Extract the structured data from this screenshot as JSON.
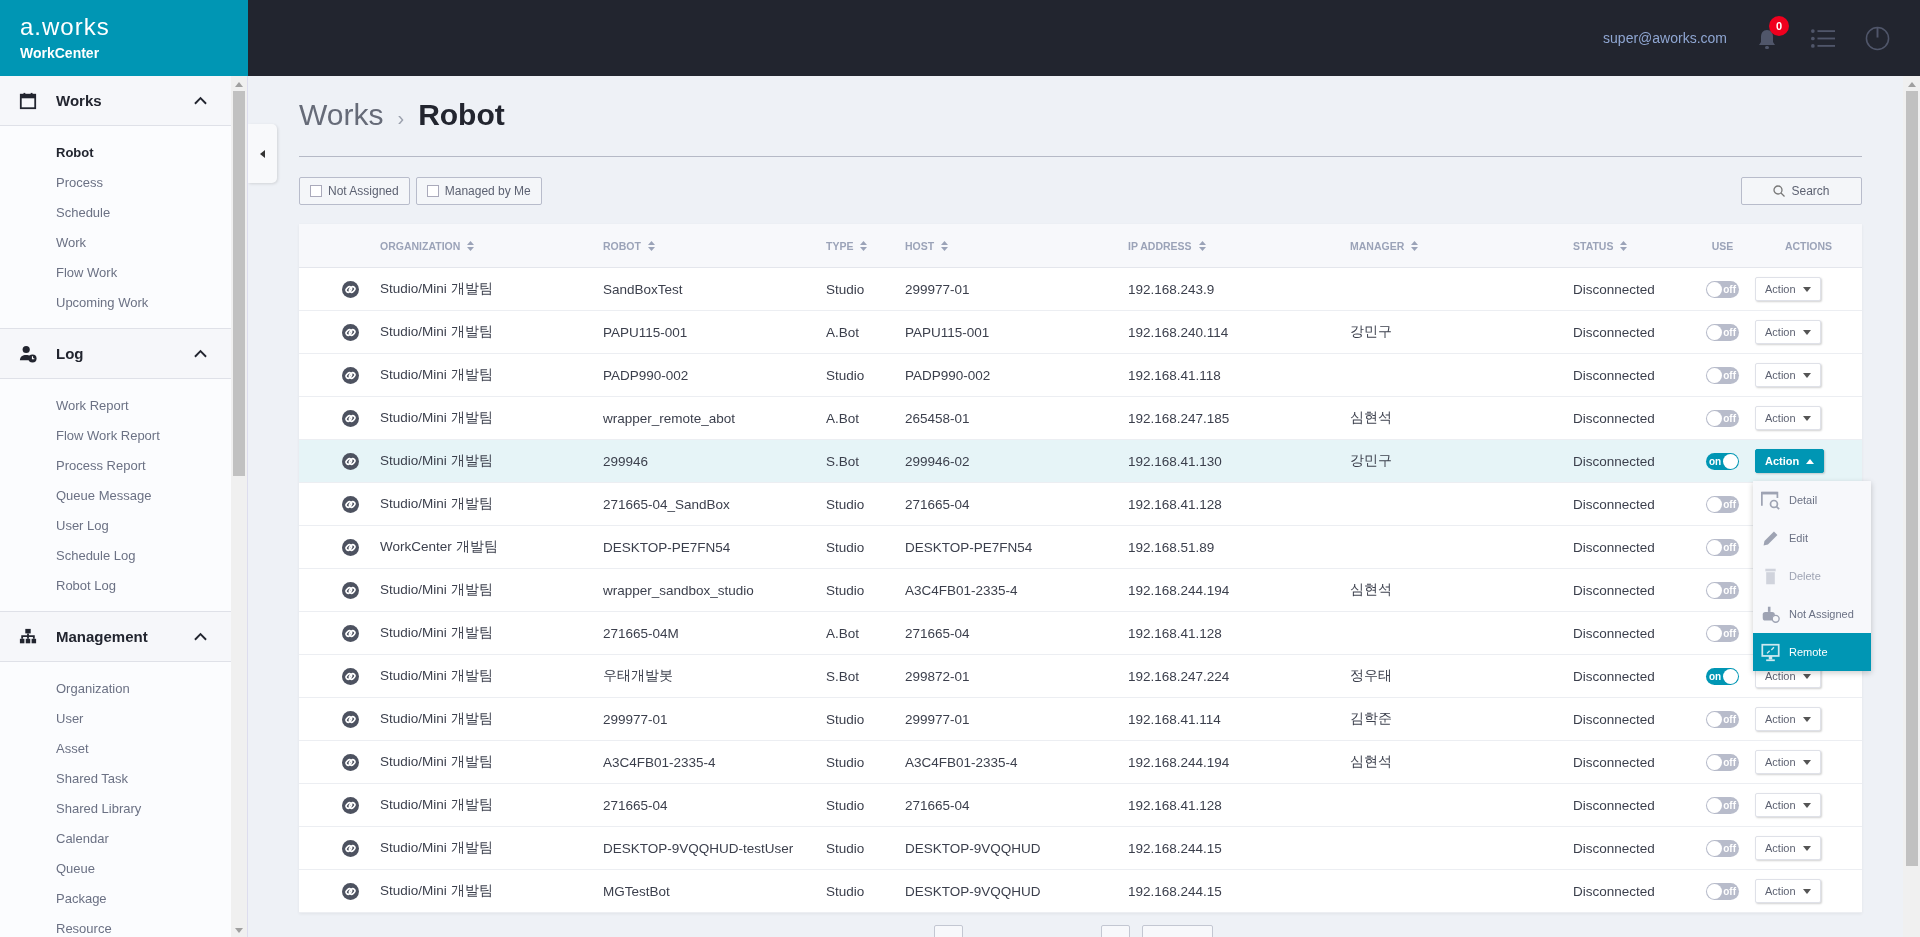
{
  "brand": {
    "logo": "a.works",
    "product": "WorkCenter"
  },
  "header": {
    "user": "super@aworks.com",
    "notifications": "0"
  },
  "sidebar": {
    "sections": [
      {
        "title": "Works",
        "kind": "calendar",
        "expanded": true,
        "items": [
          {
            "label": "Robot",
            "selected": true
          },
          {
            "label": "Process",
            "selected": false
          },
          {
            "label": "Schedule",
            "selected": false
          },
          {
            "label": "Work",
            "selected": false
          },
          {
            "label": "Flow Work",
            "selected": false
          },
          {
            "label": "Upcoming Work",
            "selected": false
          }
        ]
      },
      {
        "title": "Log",
        "kind": "user-clock",
        "expanded": true,
        "items": [
          {
            "label": "Work Report",
            "selected": false
          },
          {
            "label": "Flow Work Report",
            "selected": false
          },
          {
            "label": "Process Report",
            "selected": false
          },
          {
            "label": "Queue Message",
            "selected": false
          },
          {
            "label": "User Log",
            "selected": false
          },
          {
            "label": "Schedule Log",
            "selected": false
          },
          {
            "label": "Robot Log",
            "selected": false
          }
        ]
      },
      {
        "title": "Management",
        "kind": "sitemap",
        "expanded": true,
        "items": [
          {
            "label": "Organization",
            "selected": false
          },
          {
            "label": "User",
            "selected": false
          },
          {
            "label": "Asset",
            "selected": false
          },
          {
            "label": "Shared Task",
            "selected": false
          },
          {
            "label": "Shared Library",
            "selected": false
          },
          {
            "label": "Calendar",
            "selected": false
          },
          {
            "label": "Queue",
            "selected": false
          },
          {
            "label": "Package",
            "selected": false
          },
          {
            "label": "Resource",
            "selected": false
          }
        ]
      }
    ]
  },
  "breadcrumb": {
    "parent": "Works",
    "separator": "›",
    "current": "Robot"
  },
  "filters": [
    {
      "label": "Not Assigned",
      "checked": false
    },
    {
      "label": "Managed by Me",
      "checked": false
    }
  ],
  "search_button": "Search",
  "table": {
    "columns": [
      {
        "label": "ORGANIZATION",
        "sortable": true
      },
      {
        "label": "ROBOT",
        "sortable": true
      },
      {
        "label": "TYPE",
        "sortable": true
      },
      {
        "label": "HOST",
        "sortable": true
      },
      {
        "label": "IP ADDRESS",
        "sortable": true
      },
      {
        "label": "MANAGER",
        "sortable": true
      },
      {
        "label": "STATUS",
        "sortable": true
      },
      {
        "label": "USE",
        "sortable": false
      },
      {
        "label": "ACTIONS",
        "sortable": false
      }
    ],
    "rows": [
      {
        "organization": "Studio/Mini 개발팀",
        "robot": "SandBoxTest",
        "type": "Studio",
        "host": "299977-01",
        "ip": "192.168.243.9",
        "status": "Disconnected",
        "use": false,
        "use_label": "off",
        "selected": false,
        "action": "Action",
        "action_open": false
      },
      {
        "organization": "Studio/Mini 개발팀",
        "robot": "PAPU115-001",
        "type": "A.Bot",
        "host": "PAPU115-001",
        "ip": "192.168.240.114",
        "manager": "강민구",
        "status": "Disconnected",
        "use": false,
        "use_label": "off",
        "selected": false,
        "action": "Action",
        "action_open": false
      },
      {
        "organization": "Studio/Mini 개발팀",
        "robot": "PADP990-002",
        "type": "Studio",
        "host": "PADP990-002",
        "ip": "192.168.41.118",
        "status": "Disconnected",
        "use": false,
        "use_label": "off",
        "selected": false,
        "action": "Action",
        "action_open": false
      },
      {
        "organization": "Studio/Mini 개발팀",
        "robot": "wrapper_remote_abot",
        "type": "A.Bot",
        "host": "265458-01",
        "ip": "192.168.247.185",
        "manager": "심현석",
        "status": "Disconnected",
        "use": false,
        "use_label": "off",
        "selected": false,
        "action": "Action",
        "action_open": false
      },
      {
        "organization": "Studio/Mini 개발팀",
        "robot": "299946",
        "type": "S.Bot",
        "host": "299946-02",
        "ip": "192.168.41.130",
        "manager": "강민구",
        "status": "Disconnected",
        "use": true,
        "use_label": "on",
        "selected": true,
        "action": "Action",
        "action_open": true
      },
      {
        "organization": "Studio/Mini 개발팀",
        "robot": "271665-04_SandBox",
        "type": "Studio",
        "host": "271665-04",
        "ip": "192.168.41.128",
        "status": "Disconnected",
        "use": false,
        "use_label": "off",
        "selected": false
      },
      {
        "organization": "WorkCenter 개발팀",
        "robot": "DESKTOP-PE7FN54",
        "type": "Studio",
        "host": "DESKTOP-PE7FN54",
        "ip": "192.168.51.89",
        "status": "Disconnected",
        "use": false,
        "use_label": "off",
        "selected": false
      },
      {
        "organization": "Studio/Mini 개발팀",
        "robot": "wrapper_sandbox_studio",
        "type": "Studio",
        "host": "A3C4FB01-2335-4",
        "ip": "192.168.244.194",
        "manager": "심현석",
        "status": "Disconnected",
        "use": false,
        "use_label": "off",
        "selected": false
      },
      {
        "organization": "Studio/Mini 개발팀",
        "robot": "271665-04M",
        "type": "A.Bot",
        "host": "271665-04",
        "ip": "192.168.41.128",
        "status": "Disconnected",
        "use": false,
        "use_label": "off",
        "selected": false
      },
      {
        "organization": "Studio/Mini 개발팀",
        "robot": "우태개발봇",
        "type": "S.Bot",
        "host": "299872-01",
        "ip": "192.168.247.224",
        "manager": "정우태",
        "status": "Disconnected",
        "use": true,
        "use_label": "on",
        "selected": false,
        "action": "Action",
        "action_open": false
      },
      {
        "organization": "Studio/Mini 개발팀",
        "robot": "299977-01",
        "type": "Studio",
        "host": "299977-01",
        "ip": "192.168.41.114",
        "manager": "김학준",
        "status": "Disconnected",
        "use": false,
        "use_label": "off",
        "selected": false,
        "action": "Action",
        "action_open": false
      },
      {
        "organization": "Studio/Mini 개발팀",
        "robot": "A3C4FB01-2335-4",
        "type": "Studio",
        "host": "A3C4FB01-2335-4",
        "ip": "192.168.244.194",
        "manager": "심현석",
        "status": "Disconnected",
        "use": false,
        "use_label": "off",
        "selected": false,
        "action": "Action",
        "action_open": false
      },
      {
        "organization": "Studio/Mini 개발팀",
        "robot": "271665-04",
        "type": "Studio",
        "host": "271665-04",
        "ip": "192.168.41.128",
        "status": "Disconnected",
        "use": false,
        "use_label": "off",
        "selected": false,
        "action": "Action",
        "action_open": false
      },
      {
        "organization": "Studio/Mini 개발팀",
        "robot": "DESKTOP-9VQQHUD-testUser",
        "type": "Studio",
        "host": "DESKTOP-9VQQHUD",
        "ip": "192.168.244.15",
        "status": "Disconnected",
        "use": false,
        "use_label": "off",
        "selected": false,
        "action": "Action",
        "action_open": false
      },
      {
        "organization": "Studio/Mini 개발팀",
        "robot": "MGTestBot",
        "type": "Studio",
        "host": "DESKTOP-9VQQHUD",
        "ip": "192.168.244.15",
        "status": "Disconnected",
        "use": false,
        "use_label": "off",
        "selected": false,
        "action": "Action",
        "action_open": false
      }
    ]
  },
  "action_menu": {
    "items": [
      {
        "label": "Detail",
        "kind": "detail",
        "disabled": false,
        "selected": false
      },
      {
        "label": "Edit",
        "kind": "edit",
        "disabled": false,
        "selected": false
      },
      {
        "label": "Delete",
        "kind": "delete",
        "disabled": true,
        "selected": false
      },
      {
        "label": "Not Assigned",
        "kind": "unassign",
        "disabled": false,
        "selected": false
      },
      {
        "label": "Remote",
        "kind": "remote",
        "disabled": false,
        "selected": true
      }
    ]
  }
}
